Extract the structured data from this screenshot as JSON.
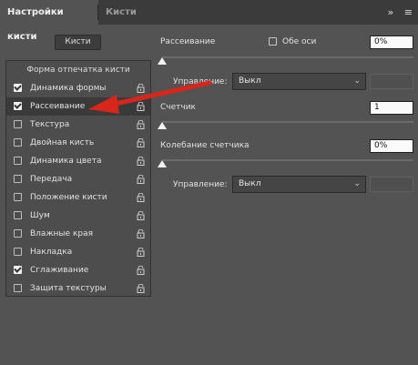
{
  "tabs": {
    "active": "Настройки кисти",
    "inactive": "Кисти"
  },
  "tabbar_icons": [
    "double-chevron-icon",
    "menu-icon"
  ],
  "brushes_button": "Кисти",
  "left_panel": {
    "header": "Форма отпечатка кисти",
    "items": [
      {
        "label": "Динамика формы",
        "checked": true
      },
      {
        "label": "Рассеивание",
        "checked": true
      },
      {
        "label": "Текстура",
        "checked": false
      },
      {
        "label": "Двойная кисть",
        "checked": false
      },
      {
        "label": "Динамика цвета",
        "checked": false
      },
      {
        "label": "Передача",
        "checked": false
      },
      {
        "label": "Положение кисти",
        "checked": false
      },
      {
        "label": "Шум",
        "checked": false
      },
      {
        "label": "Влажные края",
        "checked": false
      },
      {
        "label": "Накладка",
        "checked": false
      },
      {
        "label": "Сглаживание",
        "checked": true
      },
      {
        "label": "Защита текстуры",
        "checked": false
      }
    ]
  },
  "scatter": {
    "label": "Рассеивание",
    "both_axes_label": "Обе оси",
    "value": "0%",
    "control_label": "Управление:",
    "control_value": "Выкл"
  },
  "count": {
    "label": "Счетчик",
    "value": "1"
  },
  "count_jitter": {
    "label": "Колебание счетчика",
    "value": "0%",
    "control_label": "Управление:",
    "control_value": "Выкл"
  },
  "colors": {
    "panel": "#535353",
    "tabbar": "#3b3b3b",
    "arrow": "#d9261c"
  }
}
